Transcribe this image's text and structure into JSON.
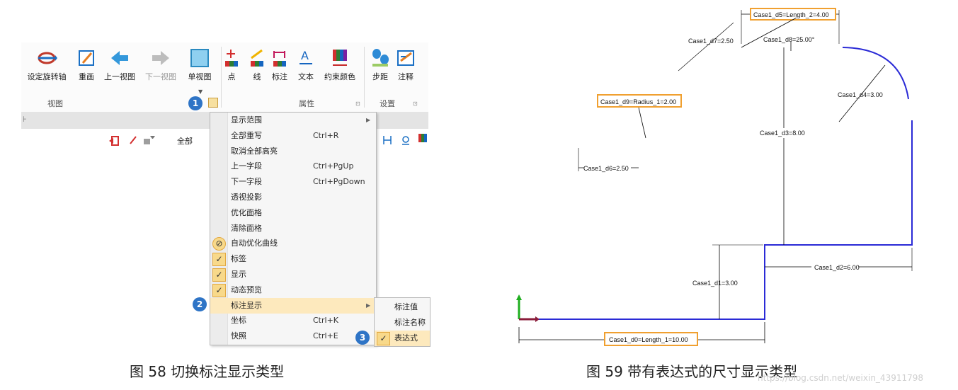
{
  "ribbon": {
    "buttons": [
      {
        "label": "设定旋转轴",
        "icon": "rotate-axis-icon"
      },
      {
        "label": "重画",
        "icon": "redraw-icon"
      },
      {
        "label": "上一视图",
        "icon": "previous-view-icon"
      },
      {
        "label": "下一视图",
        "icon": "next-view-icon"
      },
      {
        "label": "单视图",
        "icon": "single-view-icon"
      },
      {
        "label": "点",
        "icon": "point-icon"
      },
      {
        "label": "线",
        "icon": "line-icon"
      },
      {
        "label": "标注",
        "icon": "dimension-icon"
      },
      {
        "label": "文本",
        "icon": "text-icon"
      },
      {
        "label": "约束颜色",
        "icon": "constraint-color-icon"
      },
      {
        "label": "步距",
        "icon": "step-icon"
      },
      {
        "label": "注释",
        "icon": "annotation-icon"
      }
    ],
    "groups": [
      "视图",
      "属性",
      "设置"
    ]
  },
  "toolbar2": {
    "filter_label": "全部"
  },
  "menu": {
    "items": [
      {
        "label": "显示范围",
        "shortcut": "",
        "has_sub": true
      },
      {
        "label": "全部重写",
        "shortcut": "Ctrl+R"
      },
      {
        "label": "取消全部高亮",
        "shortcut": ""
      },
      {
        "label": "上一字段",
        "shortcut": "Ctrl+PgUp"
      },
      {
        "label": "下一字段",
        "shortcut": "Ctrl+PgDown"
      },
      {
        "label": "透视投影",
        "shortcut": ""
      },
      {
        "label": "优化面格",
        "shortcut": ""
      },
      {
        "label": "清除面格",
        "shortcut": ""
      },
      {
        "label": "自动优化曲线",
        "shortcut": ""
      },
      {
        "label": "标签",
        "shortcut": "",
        "checked": true
      },
      {
        "label": "显示",
        "shortcut": "",
        "checked": true
      },
      {
        "label": "动态预览",
        "shortcut": "",
        "checked": true
      },
      {
        "label": "标注显示",
        "shortcut": "",
        "has_sub": true,
        "highlighted": true
      },
      {
        "label": "坐标",
        "shortcut": "Ctrl+K"
      },
      {
        "label": "快照",
        "shortcut": "Ctrl+E"
      }
    ]
  },
  "submenu": {
    "items": [
      {
        "label": "标注值"
      },
      {
        "label": "标注名称"
      },
      {
        "label": "表达式",
        "checked": true,
        "highlighted": true
      }
    ]
  },
  "badges": [
    "1",
    "2",
    "3"
  ],
  "captions": {
    "left": "图 58   切换标注显示类型",
    "right": "图 59   带有表达式的尺寸显示类型",
    "watermark": "https://blog.csdn.net/weixin_43911798"
  },
  "drawing": {
    "dims": {
      "d0": "Case1_d0=Length_1=10.00",
      "d1": "Case1_d1=3.00",
      "d2": "Case1_d2=6.00",
      "d3": "Case1_d3=8.00",
      "d4": "Case1_d4=3.00",
      "d5": "Case1_d5=Length_2=4.00",
      "d6": "Case1_d6=2.50",
      "d7": "Case1_d7=2.50",
      "d8": "Case1_d8=25.00°",
      "d9": "Case1_d9=Radius_1=2.00"
    },
    "colors": {
      "profile": "#2a2ad6",
      "highlight_box": "#f0a030",
      "dim_line": "#000000"
    }
  }
}
